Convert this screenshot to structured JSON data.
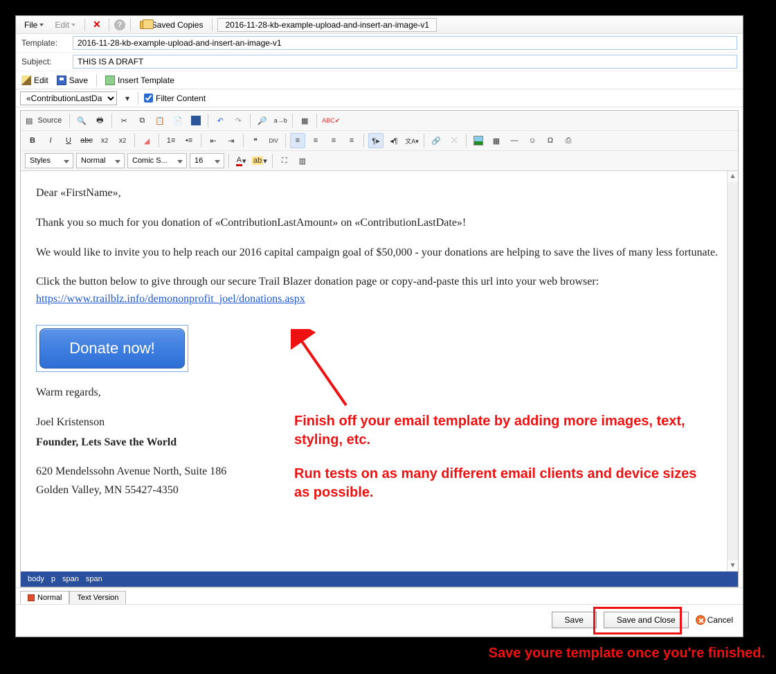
{
  "menubar": {
    "file": "File",
    "edit": "Edit",
    "saved_copies": "Saved Copies",
    "title_tab": "2016-11-28-kb-example-upload-and-insert-an-image-v1"
  },
  "fields": {
    "template_label": "Template:",
    "template_value": "2016-11-28-kb-example-upload-and-insert-an-image-v1",
    "subject_label": "Subject:",
    "subject_value": "THIS IS A DRAFT"
  },
  "toolbar2": {
    "edit": "Edit",
    "save": "Save",
    "insert_template": "Insert Template"
  },
  "merge_row": {
    "merge_field": "«ContributionLastDate",
    "filter_content": "Filter Content"
  },
  "rte": {
    "source": "Source",
    "styles": "Styles",
    "format": "Normal",
    "font": "Comic S...",
    "size": "16"
  },
  "email": {
    "greeting": "Dear «FirstName»,",
    "p1": "Thank you so much for you donation of «ContributionLastAmount» on «ContributionLastDate»!",
    "p2": "We would like to invite you to help reach our 2016 capital campaign goal of $50,000 - your donations are helping to save the lives of many less fortunate.",
    "p3_pre": "Click the button below to give through our secure Trail Blazer donation page or copy-and-paste this url into your web browser: ",
    "p3_link": "https://www.trailblz.info/demononprofit_joel/donations.aspx",
    "donate_btn": "Donate now!",
    "closing": "Warm regards,",
    "sig_name": "Joel Kristenson",
    "sig_title": "Founder, Lets Save the World",
    "addr1": "620 Mendelssohn Avenue North, Suite 186",
    "addr2": "Golden Valley, MN 55427-4350"
  },
  "annotation": {
    "line1": "Finish off your email template by adding more images, text, styling, etc.",
    "line2": "Run tests on as many different email clients and device sizes as possible."
  },
  "pathbar": {
    "a": "body",
    "b": "p",
    "c": "span",
    "d": "span"
  },
  "bottom_tabs": {
    "normal": "Normal",
    "text": "Text Version"
  },
  "footer": {
    "save": "Save",
    "save_close": "Save and Close",
    "cancel": "Cancel"
  },
  "outside_caption": "Save youre template once you're finished."
}
